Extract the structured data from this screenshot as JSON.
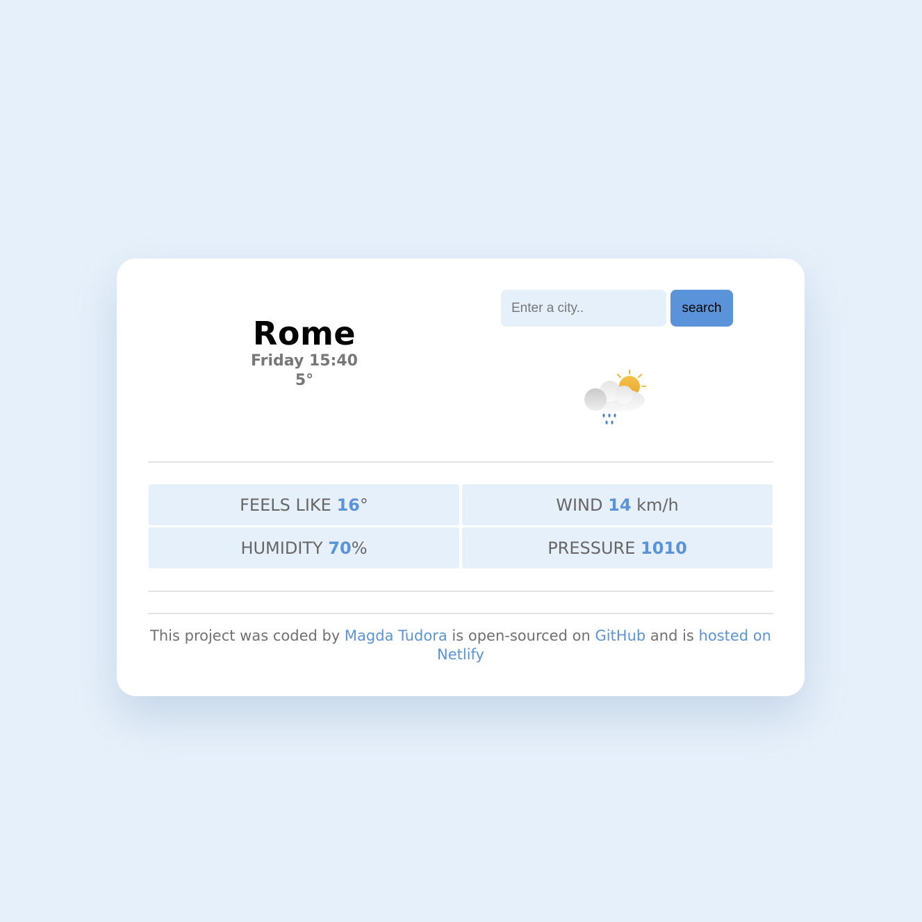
{
  "colors": {
    "page_background": "#e6f0fa",
    "card_background": "#ffffff",
    "accent": "#5b93db",
    "muted_text": "#777777"
  },
  "city": {
    "name": "Rome",
    "datetime": "Friday 15:40",
    "temperature": "5°"
  },
  "search": {
    "placeholder": "Enter a city..",
    "button_label": "search"
  },
  "weather_icon": "partly-cloudy-rain-icon",
  "stats": {
    "feels_like": {
      "label": "FEELS LIKE ",
      "value": "16",
      "unit": "°"
    },
    "wind": {
      "label": "WIND ",
      "value": "14",
      "unit": " km/h"
    },
    "humidity": {
      "label": "HUMIDITY ",
      "value": "70",
      "unit": "%"
    },
    "pressure": {
      "label": "PRESSURE ",
      "value": "1010",
      "unit": ""
    }
  },
  "footer": {
    "text_1": "This project was coded by ",
    "author_link": "Magda Tudora",
    "text_2": " is open-sourced on ",
    "github_link": "GitHub",
    "text_3": " and is ",
    "hosting_link": "hosted on Netlify"
  }
}
